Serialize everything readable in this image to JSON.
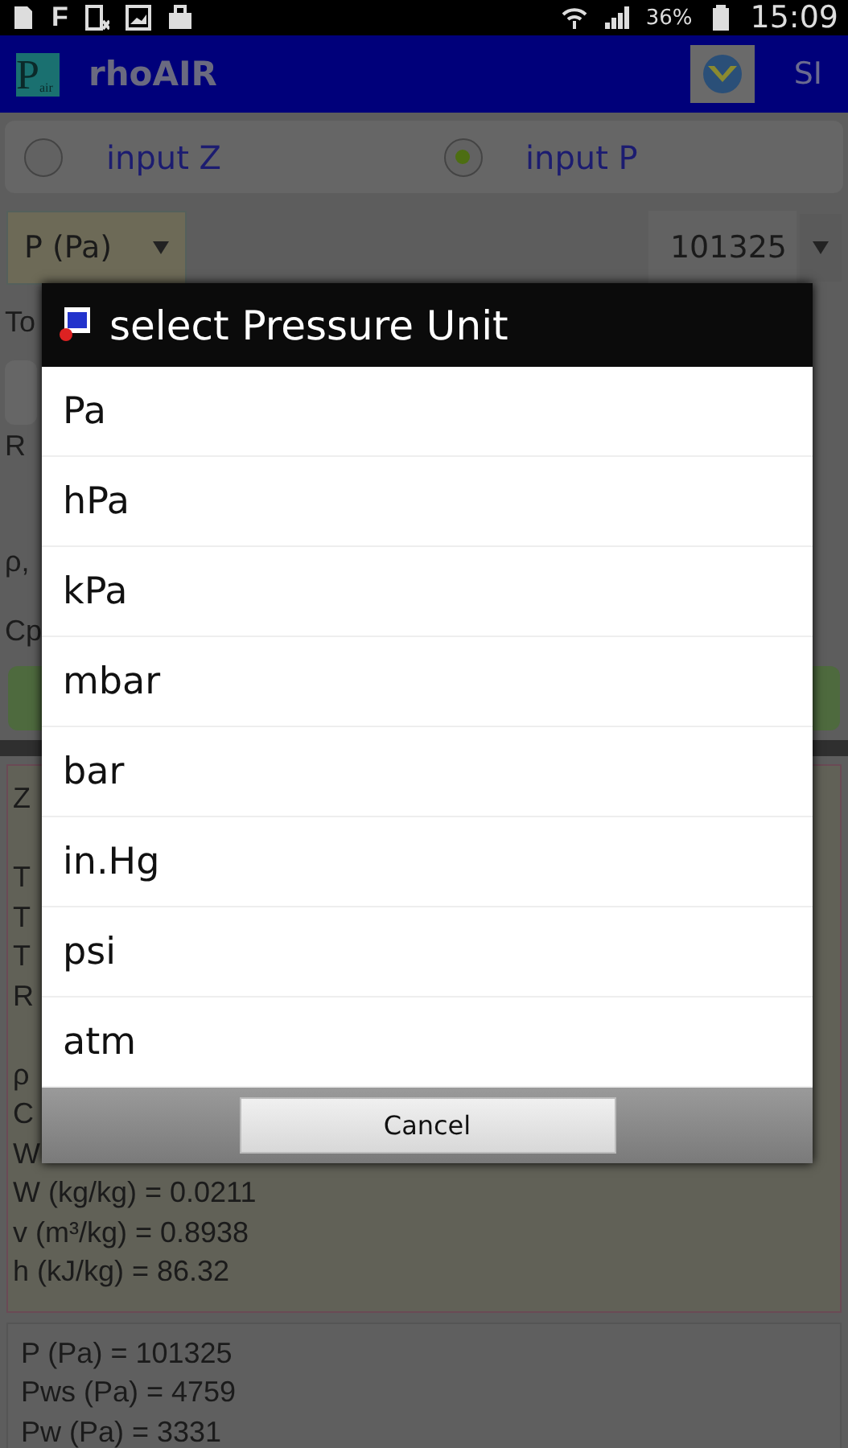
{
  "status_bar": {
    "notifications": [
      "F"
    ],
    "battery": "36%",
    "time": "15:09"
  },
  "app_bar": {
    "logo": {
      "letter": "P",
      "sub": "air"
    },
    "title": "rhoAIR",
    "unit_button": "SI"
  },
  "input_mode": [
    {
      "label": "input Z",
      "selected": false
    },
    {
      "label": "input P",
      "selected": true
    }
  ],
  "pressure": {
    "unit": "P (Pa)",
    "value": "101325"
  },
  "partial_labels": [
    "To",
    "R",
    "ρ,",
    "Cp"
  ],
  "results": [
    [
      "Z"
    ],
    [
      "T",
      "T",
      "T",
      "R"
    ],
    [
      "ρ",
      "C",
      "W",
      "W (kg/kg) = 0.0211",
      "v (m³/kg) = 0.8938",
      "h (kJ/kg) = 86.32"
    ]
  ],
  "pressures": [
    "P (Pa) = 101325",
    "Pws (Pa) = 4759",
    "Pw (Pa) = 3331"
  ],
  "dialog": {
    "title": "select Pressure Unit",
    "options": [
      "Pa",
      "hPa",
      "kPa",
      "mbar",
      "bar",
      "in.Hg",
      "psi",
      "atm"
    ],
    "button": "Cancel"
  }
}
